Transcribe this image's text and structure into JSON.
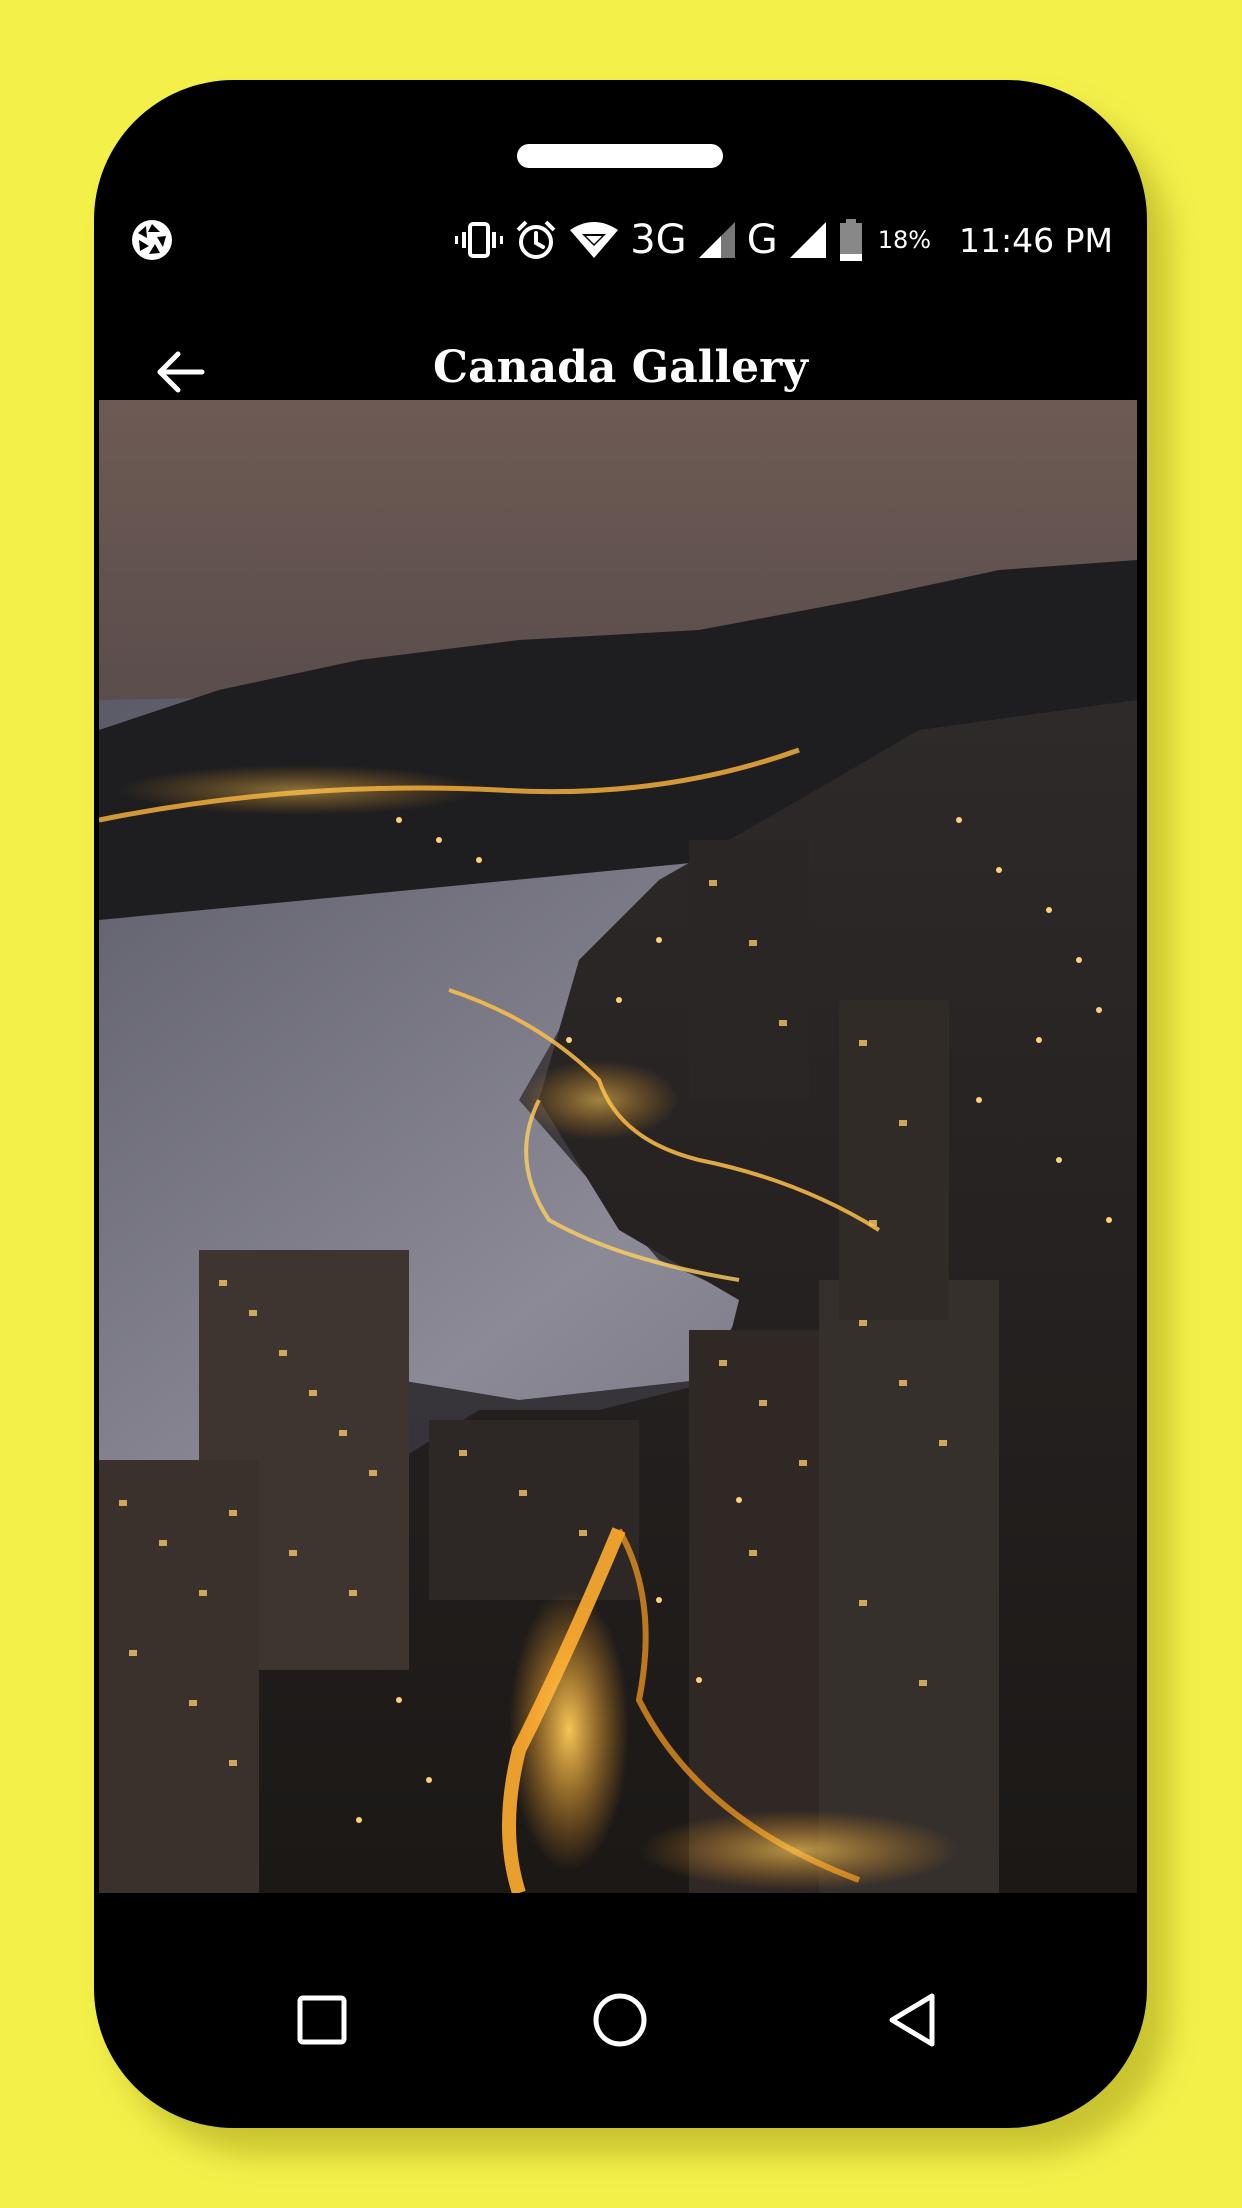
{
  "status_bar": {
    "network_3g": "3G",
    "network_g": "G",
    "battery_percent": "18%",
    "time": "11:46 PM",
    "icons": [
      "aperture-icon",
      "vibrate-icon",
      "alarm-icon",
      "wifi-icon",
      "signal-icon",
      "battery-icon"
    ]
  },
  "app_bar": {
    "title": "Canada Gallery",
    "back_icon": "arrow-left-icon"
  },
  "gallery": {
    "image_subject": "city-night-coastline-photo"
  },
  "nav_bar": {
    "icons": [
      "recents-square-icon",
      "home-circle-icon",
      "back-triangle-icon"
    ]
  },
  "colors": {
    "background": "#f3f04a",
    "phone_body": "#000000",
    "text": "#ffffff"
  }
}
